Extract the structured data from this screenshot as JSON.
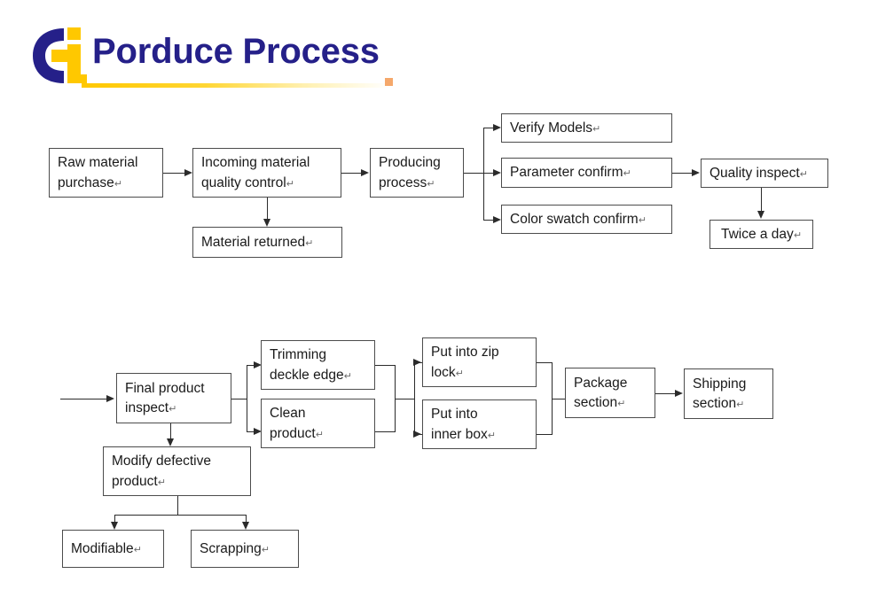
{
  "header": {
    "title": "Porduce Process",
    "logo_name": "ci-logo",
    "logo_navy": "#252089",
    "logo_gold": "#FFC800",
    "rule_accent": "#FFC800",
    "dot_color": "#F5A86B"
  },
  "paragraph_mark": "↵",
  "flow1": {
    "boxes": [
      {
        "id": "raw-material-purchase",
        "lines": [
          "Raw material",
          "purchase"
        ],
        "mark_on_line": 1
      },
      {
        "id": "incoming-material-qc",
        "lines": [
          "Incoming material",
          "quality control"
        ],
        "mark_on_line": 1
      },
      {
        "id": "material-returned",
        "lines": [
          "Material returned"
        ],
        "mark_on_line": 0
      },
      {
        "id": "producing-process",
        "lines": [
          "Producing",
          "process"
        ],
        "mark_on_line": 1
      },
      {
        "id": "verify-models",
        "lines": [
          "Verify Models"
        ],
        "mark_on_line": 0
      },
      {
        "id": "parameter-confirm",
        "lines": [
          "Parameter confirm"
        ],
        "mark_on_line": 0
      },
      {
        "id": "color-swatch-confirm",
        "lines": [
          "Color swatch confirm"
        ],
        "mark_on_line": 0
      },
      {
        "id": "quality-inspect",
        "lines": [
          "Quality inspect"
        ],
        "mark_on_line": 0
      },
      {
        "id": "twice-a-day",
        "lines": [
          "Twice a day"
        ],
        "mark_on_line": 0
      }
    ]
  },
  "flow2": {
    "boxes": [
      {
        "id": "final-product-inspect",
        "lines": [
          "Final product",
          "inspect"
        ],
        "mark_on_line": 1
      },
      {
        "id": "trimming-deckle-edge",
        "lines": [
          "Trimming",
          "deckle edge"
        ],
        "mark_on_line": 1
      },
      {
        "id": "clean-product",
        "lines": [
          "Clean",
          "product"
        ],
        "mark_on_line": 1
      },
      {
        "id": "put-into-zip-lock",
        "lines": [
          "Put into zip",
          "lock"
        ],
        "mark_on_line": 1
      },
      {
        "id": "put-into-inner-box",
        "lines": [
          "Put into",
          "inner box"
        ],
        "mark_on_line": 1
      },
      {
        "id": "package-section",
        "lines": [
          "Package",
          "section"
        ],
        "mark_on_line": 1
      },
      {
        "id": "shipping-section",
        "lines": [
          "Shipping",
          "section"
        ],
        "mark_on_line": 1
      },
      {
        "id": "modify-defective-product",
        "lines": [
          "Modify defective",
          "product"
        ],
        "mark_on_line": 1
      },
      {
        "id": "modifiable",
        "lines": [
          "Modifiable"
        ],
        "mark_on_line": 0
      },
      {
        "id": "scrapping",
        "lines": [
          "Scrapping"
        ],
        "mark_on_line": 0
      }
    ]
  },
  "labels": {
    "raw_material_l1": "Raw material",
    "raw_material_l2": "purchase",
    "incoming_l1": "Incoming material",
    "incoming_l2": "quality control",
    "material_returned": "Material returned",
    "producing_l1": "Producing",
    "producing_l2": "process",
    "verify_models": "Verify Models",
    "parameter_confirm": "Parameter confirm",
    "color_swatch_confirm": "Color swatch confirm",
    "quality_inspect": "Quality inspect",
    "twice_a_day": "Twice a day",
    "final_product_l1": "Final product",
    "final_product_l2": "inspect",
    "trimming_l1": "Trimming",
    "trimming_l2": "deckle edge",
    "clean_l1": "Clean",
    "clean_l2": "product",
    "zip_l1": "Put into zip",
    "zip_l2": "lock",
    "inner_l1": "Put into",
    "inner_l2": "inner box",
    "package_l1": "Package",
    "package_l2": "section",
    "shipping_l1": "Shipping",
    "shipping_l2": "section",
    "modify_l1": "Modify defective",
    "modify_l2": "product",
    "modifiable": "Modifiable",
    "scrapping": "Scrapping"
  }
}
